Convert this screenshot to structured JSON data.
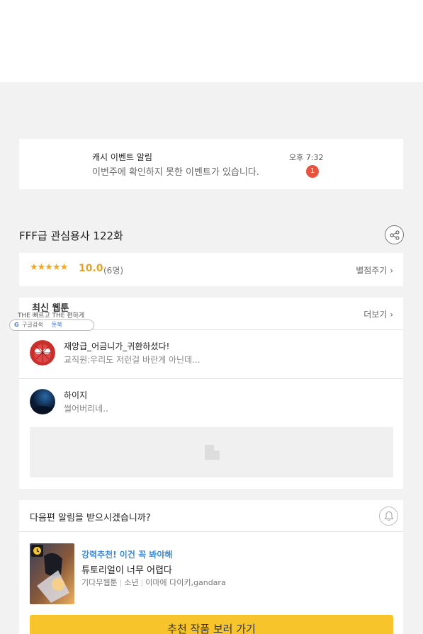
{
  "notification": {
    "title": "캐시 이벤트 알림",
    "message": "이번주에 확인하지 못한 이벤트가 있습니다.",
    "time": "오후 7:32",
    "badge": "1"
  },
  "episode": {
    "title": "FFF급 관심용사 122화",
    "share_icon": "share-icon"
  },
  "rating": {
    "stars": "★★★★★",
    "score": "10.0",
    "count": "(6명)",
    "rate_link": "별점주기 ›"
  },
  "latest": {
    "title": "최신 웹툰",
    "more_link": "더보기 ›",
    "ad_line": "THE 빠르고 THE 편하게",
    "ad_pill_left": "구글검색",
    "ad_pill_right": "툰북",
    "comments": [
      {
        "name": "재앙급_어금니가_귀환하셨다!",
        "text": "교직원:우리도 저런걸 바란게 아닌데..."
      },
      {
        "name": "하이지",
        "text": "썰어버리네.."
      }
    ]
  },
  "next": {
    "question": "다음편 알림을 받으시겠습니까?",
    "tag": "강력추천! 이건 꼭 봐야해",
    "title": "튜토리얼이 너무 어렵다",
    "meta": [
      "기다무웹툰",
      "소년",
      "이마에 다이키,gandara"
    ],
    "cta": "추천 작품 보러 가기"
  },
  "colors": {
    "star": "#f5a623",
    "badge": "#e8553e",
    "tag": "#3b8ad9",
    "cta": "#f7c52b"
  }
}
